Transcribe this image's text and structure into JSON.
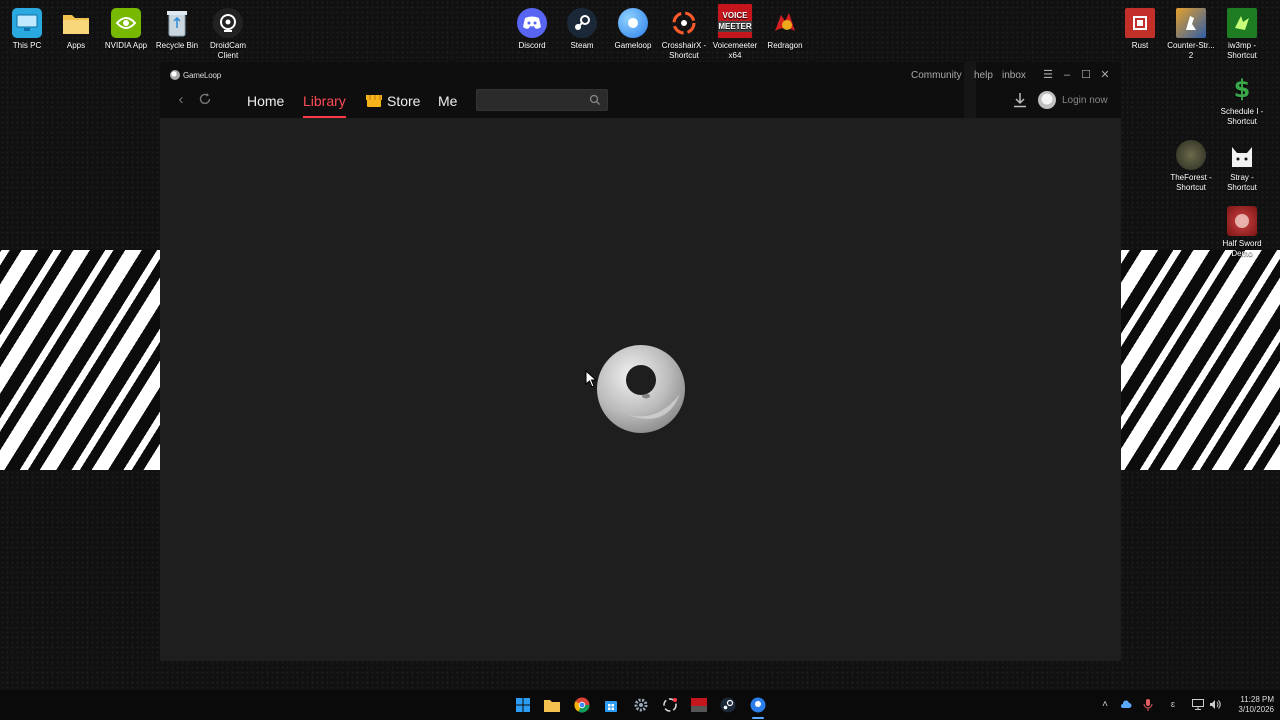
{
  "desktop": {
    "icons_left": [
      {
        "label": "This PC",
        "icon": "monitor-icon",
        "color": "#2aa9e0"
      },
      {
        "label": "Apps",
        "icon": "folder-icon",
        "color": "#f2c14e"
      },
      {
        "label": "NVIDIA App",
        "icon": "nvidia-icon",
        "color": "#76b900"
      },
      {
        "label": "Recycle Bin",
        "icon": "recycle-bin-icon",
        "color": "#9ab"
      },
      {
        "label": "DroidCam Client",
        "icon": "webcam-icon",
        "color": "#333"
      }
    ],
    "icons_top": [
      {
        "label": "Discord",
        "icon": "discord-icon",
        "color": "#5865f2"
      },
      {
        "label": "Steam",
        "icon": "steam-icon",
        "color": "#1b2838"
      },
      {
        "label": "Gameloop",
        "icon": "gameloop-icon",
        "color": "#2b7de9"
      },
      {
        "label": "CrosshairX - Shortcut",
        "icon": "crosshair-icon",
        "color": "#222"
      },
      {
        "label": "Voicemeeter x64",
        "icon": "voicemeeter-icon",
        "color": "#c4161c",
        "text_top": "VOICE",
        "text_bottom": "MEETER"
      },
      {
        "label": "Redragon",
        "icon": "redragon-icon",
        "color": "#d21f1f"
      }
    ],
    "icons_right": [
      {
        "label": "Rust",
        "icon": "rust-icon",
        "color": "#c3302a"
      },
      {
        "label": "Counter-Str... 2",
        "icon": "counter-strike-icon",
        "color": "#e5a02b"
      },
      {
        "label": "iw3mp - Shortcut",
        "icon": "iw3mp-icon",
        "color": "#1e7d22"
      },
      {
        "label": "Schedule I - Shortcut",
        "icon": "schedule-icon",
        "color": "#3aa84a"
      },
      {
        "label": "TheForest - Shortcut",
        "icon": "the-forest-icon",
        "color": "#3b3b2d"
      },
      {
        "label": "Stray - Shortcut",
        "icon": "stray-cat-icon",
        "color": "#f2f2f2"
      },
      {
        "label": "Half Sword Demo",
        "icon": "half-sword-icon",
        "color": "#a82424"
      }
    ]
  },
  "window": {
    "brand": "GameLoop",
    "nav": {
      "back_icon": "chevron-left-icon",
      "refresh_icon": "refresh-icon",
      "tabs": [
        {
          "label": "Home"
        },
        {
          "label": "Library",
          "active": true
        },
        {
          "label": "Store"
        },
        {
          "label": "Me"
        }
      ]
    },
    "search": {
      "value": "",
      "placeholder": ""
    },
    "top_links": {
      "community": "Community",
      "help": "help",
      "inbox": "inbox"
    },
    "login": "Login now",
    "accent_color": "#ff3a48"
  },
  "taskbar": {
    "apps": [
      "windows-start-icon",
      "file-explorer-icon",
      "chrome-icon",
      "microsoft-store-icon",
      "settings-icon",
      "crosshair-icon",
      "voicemeeter-icon",
      "steam-icon",
      "gameloop-icon"
    ],
    "tray": {
      "ime": "ɛ"
    },
    "clock": {
      "time": "11:28 PM",
      "date": "3/10/2026"
    }
  }
}
